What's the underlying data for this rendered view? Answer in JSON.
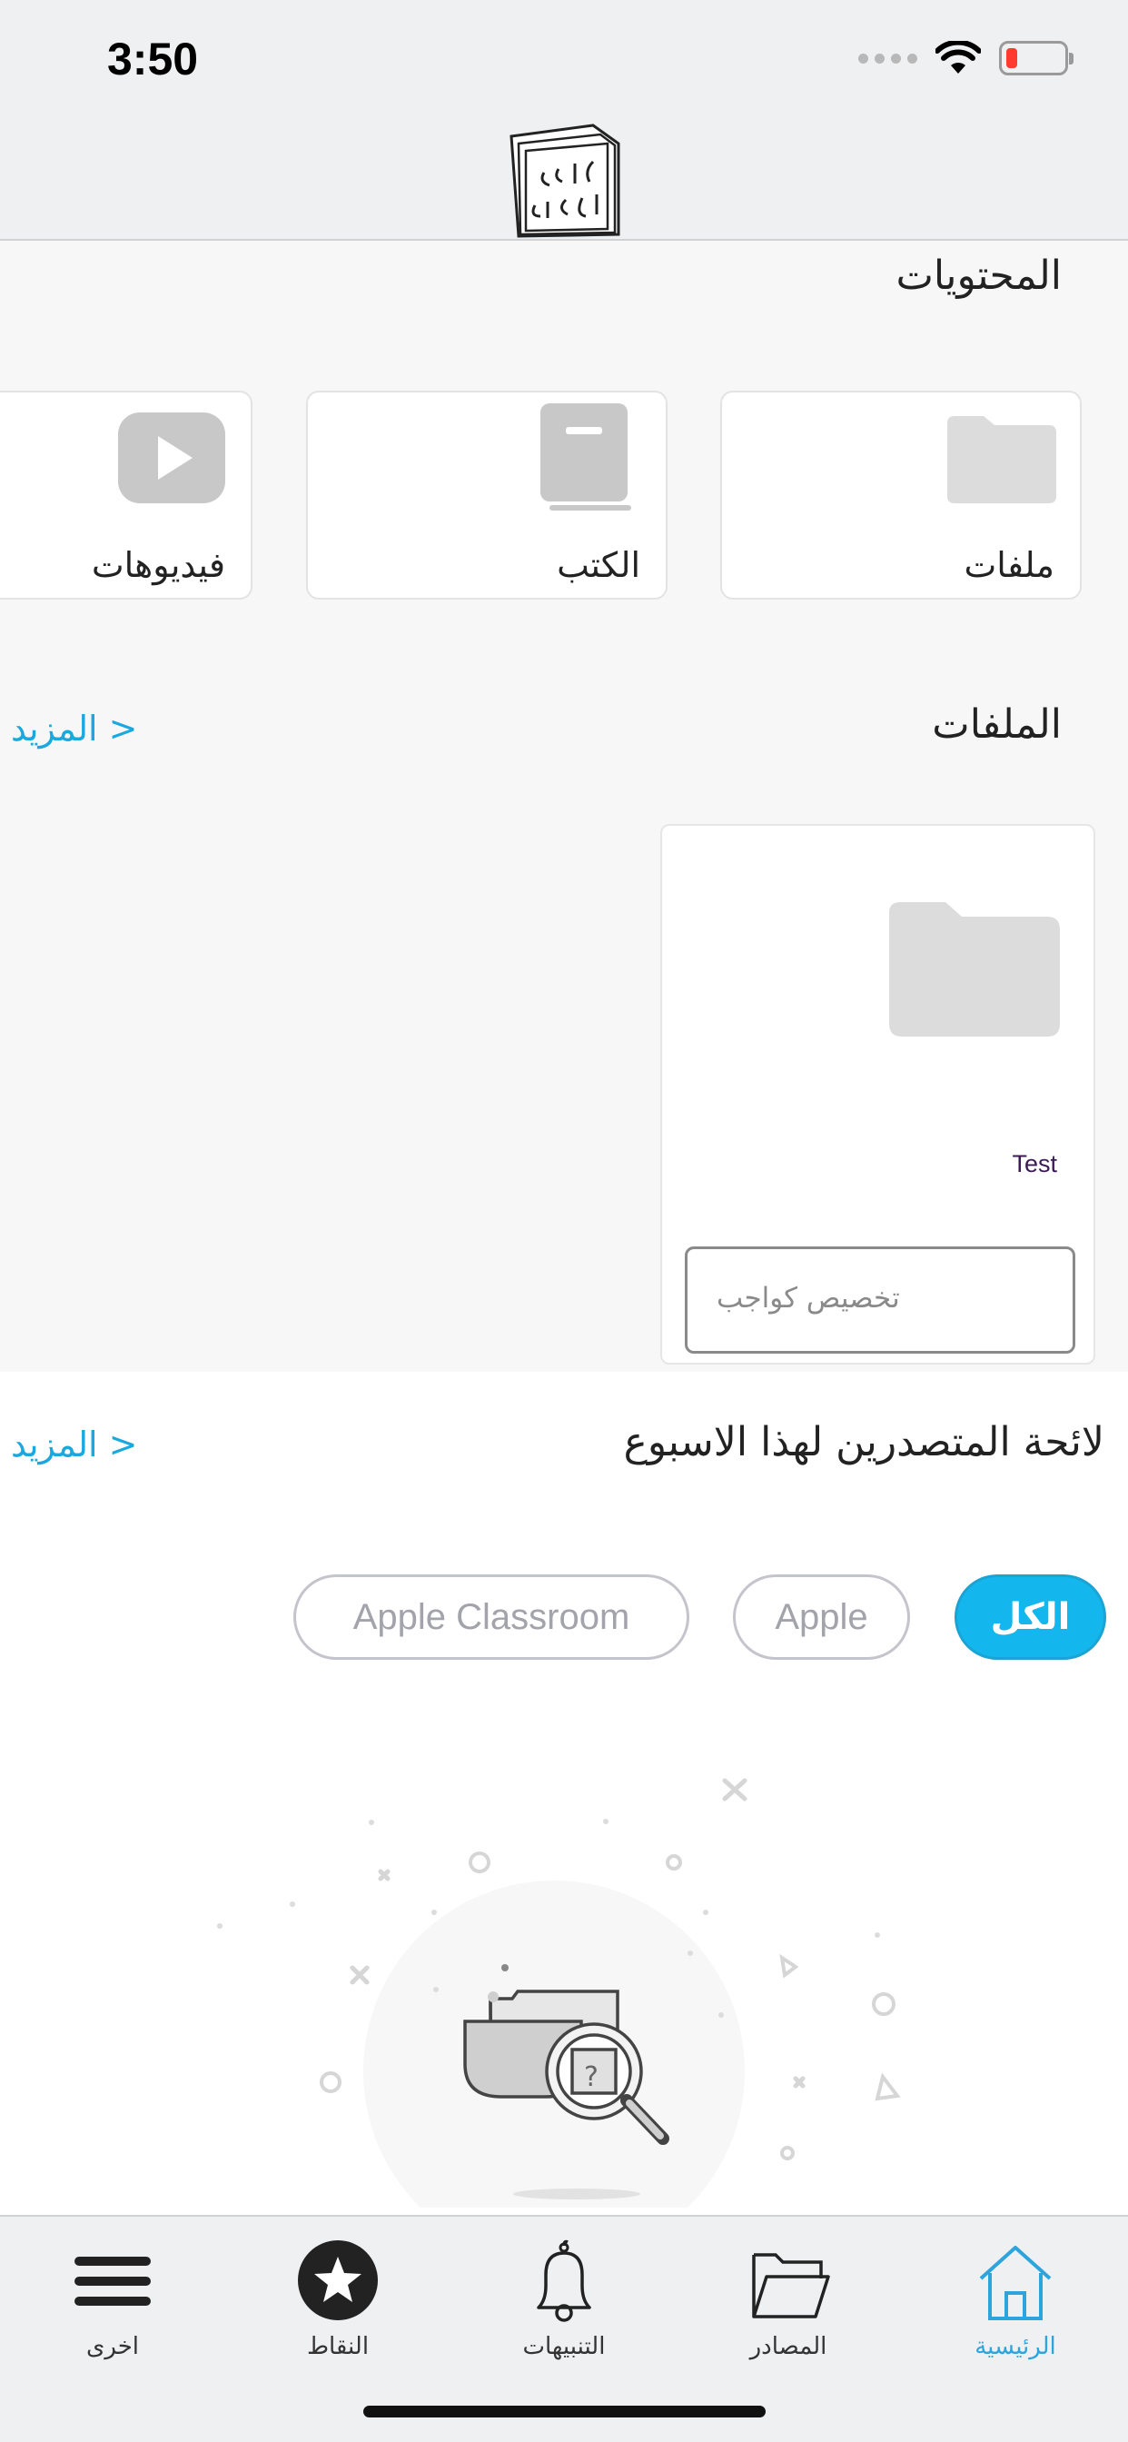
{
  "status_bar": {
    "time": "3:50"
  },
  "header": {
    "logo_text": "أقرأ بالعربية"
  },
  "contents": {
    "title": "المحتويات",
    "cards": [
      {
        "label": "ملفات",
        "icon": "folder-icon"
      },
      {
        "label": "الكتب",
        "icon": "book-icon"
      },
      {
        "label": "فيديوهات",
        "icon": "video-play-icon"
      }
    ]
  },
  "files": {
    "title": "الملفات",
    "more": "< المزيد",
    "items": [
      {
        "name": "Test",
        "icon": "folder-icon",
        "assign_label": "تخصيص كواجب"
      }
    ]
  },
  "leaderboard": {
    "title": "لائحة المتصدرين لهذا الاسبوع",
    "more": "< المزيد",
    "filters": [
      {
        "label": "الكل",
        "active": true
      },
      {
        "label": "Apple",
        "active": false
      },
      {
        "label": "Apple Classroom",
        "active": false
      }
    ]
  },
  "tab_bar": {
    "tabs": [
      {
        "label": "الرئيسية",
        "icon": "home-icon",
        "active": true
      },
      {
        "label": "المصادر",
        "icon": "folder-icon",
        "active": false
      },
      {
        "label": "التنبيهات",
        "icon": "bell-icon",
        "active": false
      },
      {
        "label": "النقاط",
        "icon": "star-icon",
        "active": false
      },
      {
        "label": "اخرى",
        "icon": "menu-icon",
        "active": false
      }
    ]
  },
  "colors": {
    "accent": "#14b7ed",
    "link": "#1aa8de",
    "battery_low": "#ff3b30"
  }
}
